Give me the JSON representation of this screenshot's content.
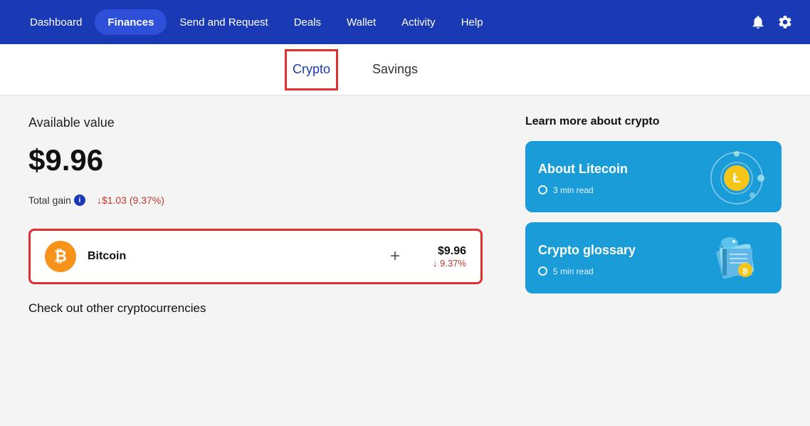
{
  "navbar": {
    "items": [
      {
        "id": "dashboard",
        "label": "Dashboard",
        "active": false
      },
      {
        "id": "finances",
        "label": "Finances",
        "active": true
      },
      {
        "id": "send-request",
        "label": "Send and Request",
        "active": false
      },
      {
        "id": "deals",
        "label": "Deals",
        "active": false
      },
      {
        "id": "wallet",
        "label": "Wallet",
        "active": false
      },
      {
        "id": "activity",
        "label": "Activity",
        "active": false
      },
      {
        "id": "help",
        "label": "Help",
        "active": false
      }
    ]
  },
  "subnav": {
    "items": [
      {
        "id": "crypto",
        "label": "Crypto",
        "active": true
      },
      {
        "id": "savings",
        "label": "Savings",
        "active": false
      }
    ]
  },
  "main": {
    "available_label": "Available value",
    "available_value": "$9.96",
    "total_gain_label": "Total gain",
    "total_gain_value": "↓$1.03 (9.37%)",
    "bitcoin": {
      "name": "Bitcoin",
      "plus": "+",
      "amount": "$9.96",
      "change": "↓ 9.37%"
    },
    "check_other": "Check out other cryptocurrencies"
  },
  "right": {
    "learn_label": "Learn more about crypto",
    "cards": [
      {
        "id": "litecoin",
        "title": "About Litecoin",
        "time": "3 min read"
      },
      {
        "id": "glossary",
        "title": "Crypto glossary",
        "time": "5 min read"
      }
    ]
  }
}
